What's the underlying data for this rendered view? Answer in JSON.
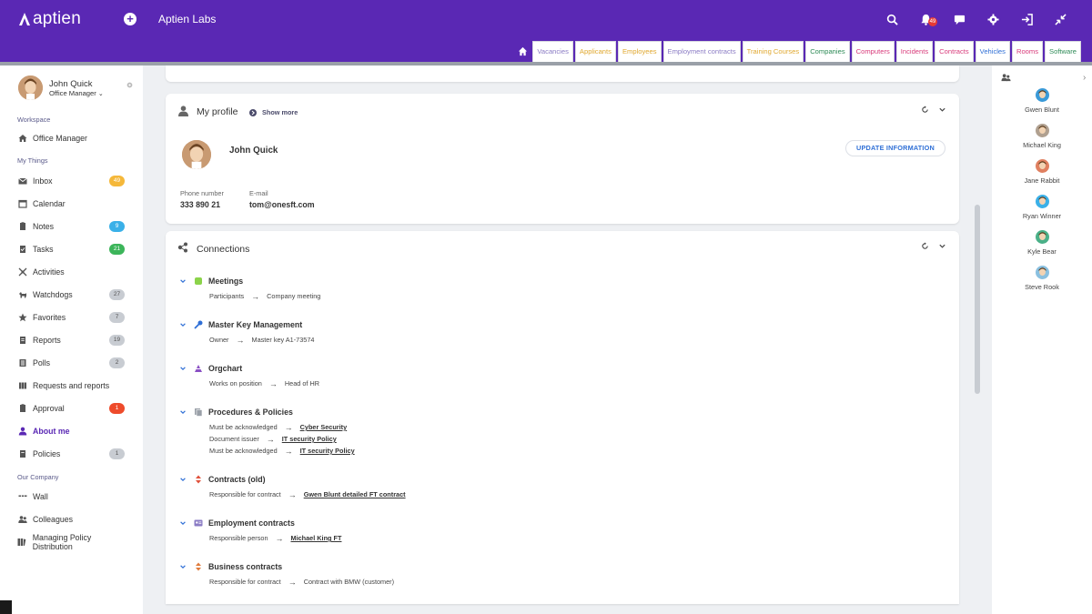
{
  "app": {
    "logo_text": "aptien",
    "org_name": "Aptien Labs",
    "notification_count": "49"
  },
  "colors": {
    "brand": "#5a28b4",
    "badge_yellow": "#f5b83a",
    "badge_blue": "#3ab0e8",
    "badge_green": "#3cb55a",
    "badge_gray": "#c8ccd2",
    "badge_red": "#ee4b2b",
    "link_blue": "#2f6fd6"
  },
  "tabs": [
    {
      "label": "Vacancies",
      "color": "#8a7bc4"
    },
    {
      "label": "Applicants",
      "color": "#e0a830"
    },
    {
      "label": "Employees",
      "color": "#e0a830"
    },
    {
      "label": "Employment contracts",
      "color": "#8a7bc4"
    },
    {
      "label": "Training Courses",
      "color": "#e0a830"
    },
    {
      "label": "Companies",
      "color": "#2e8b57"
    },
    {
      "label": "Computers",
      "color": "#d83a7a"
    },
    {
      "label": "Incidents",
      "color": "#d83a7a"
    },
    {
      "label": "Contracts",
      "color": "#d83a7a"
    },
    {
      "label": "Vehicles",
      "color": "#2f6fd6"
    },
    {
      "label": "Rooms",
      "color": "#d83a7a"
    },
    {
      "label": "Software",
      "color": "#2e8b57"
    }
  ],
  "sidebar": {
    "user_name": "John Quick",
    "user_role": "Office Manager",
    "sections": {
      "workspace": "Workspace",
      "my_things": "My Things",
      "our_company": "Our Company"
    },
    "workspace_items": [
      {
        "label": "Office Manager",
        "icon": "home-icon"
      }
    ],
    "my_things_items": [
      {
        "label": "Inbox",
        "icon": "inbox-icon",
        "badge": "49",
        "badge_color": "#f5b83a"
      },
      {
        "label": "Calendar",
        "icon": "calendar-icon",
        "badge": "",
        "badge_color": ""
      },
      {
        "label": "Notes",
        "icon": "notes-icon",
        "badge": "9",
        "badge_color": "#3ab0e8"
      },
      {
        "label": "Tasks",
        "icon": "tasks-icon",
        "badge": "21",
        "badge_color": "#3cb55a"
      },
      {
        "label": "Activities",
        "icon": "activities-icon",
        "badge": "",
        "badge_color": ""
      },
      {
        "label": "Watchdogs",
        "icon": "watchdog-icon",
        "badge": "27",
        "badge_color": "#c8ccd2"
      },
      {
        "label": "Favorites",
        "icon": "star-icon",
        "badge": "7",
        "badge_color": "#c8ccd2"
      },
      {
        "label": "Reports",
        "icon": "reports-icon",
        "badge": "19",
        "badge_color": "#c8ccd2"
      },
      {
        "label": "Polls",
        "icon": "polls-icon",
        "badge": "2",
        "badge_color": "#c8ccd2"
      },
      {
        "label": "Requests and reports",
        "icon": "requests-icon",
        "badge": "",
        "badge_color": ""
      },
      {
        "label": "Approval",
        "icon": "approval-icon",
        "badge": "1",
        "badge_color": "#ee4b2b"
      },
      {
        "label": "About me",
        "icon": "person-icon",
        "badge": "",
        "badge_color": "",
        "active": true
      },
      {
        "label": "Policies",
        "icon": "policies-icon",
        "badge": "1",
        "badge_color": "#c8ccd2"
      }
    ],
    "company_items": [
      {
        "label": "Wall",
        "icon": "wall-icon"
      },
      {
        "label": "Colleagues",
        "icon": "colleagues-icon"
      },
      {
        "label": "Managing Policy Distribution",
        "icon": "policy-distribution-icon"
      }
    ]
  },
  "profile": {
    "title": "My profile",
    "show_more": "Show more",
    "name": "John Quick",
    "update_button": "UPDATE INFORMATION",
    "phone_label": "Phone number",
    "phone_value": "333 890 21",
    "email_label": "E-mail",
    "email_value": "tom@onesft.com"
  },
  "connections": {
    "title": "Connections",
    "groups": [
      {
        "title": "Meetings",
        "icon": "meeting-icon",
        "icon_color": "#8bd34a",
        "rows": [
          {
            "role": "Participants",
            "target": "Company meeting",
            "link": false
          }
        ]
      },
      {
        "title": "Master Key Management",
        "icon": "key-icon",
        "icon_color": "#2f6fd6",
        "rows": [
          {
            "role": "Owner",
            "target": "Master key A1-73574",
            "link": false
          }
        ]
      },
      {
        "title": "Orgchart",
        "icon": "orgchart-icon",
        "icon_color": "#8a4fc4",
        "rows": [
          {
            "role": "Works on position",
            "target": "Head of HR",
            "link": false
          }
        ]
      },
      {
        "title": "Procedures & Policies",
        "icon": "procedures-icon",
        "icon_color": "#9aa0a8",
        "rows": [
          {
            "role": "Must be acknowledged",
            "target": "Cyber Security",
            "link": true
          },
          {
            "role": "Document issuer",
            "target": "IT security Policy",
            "link": true
          },
          {
            "role": "Must be acknowledged",
            "target": "IT security Policy",
            "link": true
          }
        ]
      },
      {
        "title": "Contracts (old)",
        "icon": "contract-old-icon",
        "icon_color": "#e0503a",
        "rows": [
          {
            "role": "Responsible for contract",
            "target": "Gwen Blunt detailed FT contract",
            "link": true
          }
        ]
      },
      {
        "title": "Employment contracts",
        "icon": "employment-contract-icon",
        "icon_color": "#8a7bc4",
        "rows": [
          {
            "role": "Responsible person",
            "target": "Michael King FT",
            "link": true
          }
        ]
      },
      {
        "title": "Business contracts",
        "icon": "business-contract-icon",
        "icon_color": "#e07a3a",
        "rows": [
          {
            "role": "Responsible for contract",
            "target": "Contract with BMW (customer)",
            "link": false
          }
        ]
      }
    ]
  },
  "colleagues": [
    {
      "name": "Gwen Blunt",
      "bg": "#3a9ad8"
    },
    {
      "name": "Michael King",
      "bg": "#b0a090"
    },
    {
      "name": "Jane Rabbit",
      "bg": "#e08060"
    },
    {
      "name": "Ryan Winner",
      "bg": "#3ab0e8"
    },
    {
      "name": "Kyle Bear",
      "bg": "#4ab088"
    },
    {
      "name": "Steve Rook",
      "bg": "#8ac0e0"
    }
  ]
}
